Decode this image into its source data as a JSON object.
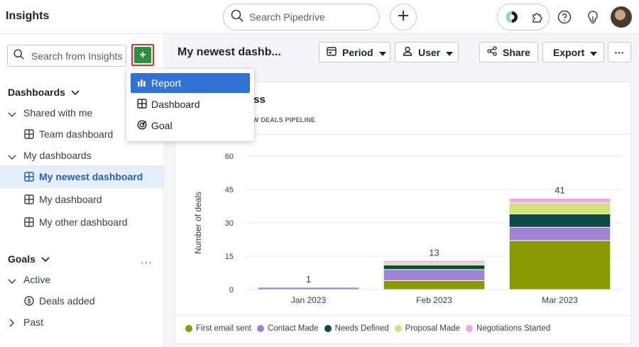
{
  "app": {
    "title": "Insights"
  },
  "topbar": {
    "search_placeholder": "Search Pipedrive",
    "icons": [
      "search-icon",
      "plus-icon",
      "sales-assistant-icon",
      "extensions-icon",
      "help-icon",
      "lightbulb-icon",
      "avatar"
    ]
  },
  "sidebar": {
    "search_placeholder": "Search from Insights",
    "add_label": "+",
    "dashboards_label": "Dashboards",
    "shared_label": "Shared with me",
    "team_dashboard": "Team dashboard",
    "my_dashboards_label": "My dashboards",
    "items": [
      "My newest dashboard",
      "My dashboard",
      "My other dashboard"
    ],
    "goals_label": "Goals",
    "goals_more": "···",
    "active_label": "Active",
    "deals_added": "Deals added",
    "past_label": "Past"
  },
  "menu": {
    "items": [
      "Report",
      "Dashboard",
      "Goal"
    ]
  },
  "main": {
    "dashboard_title": "My newest dashb...",
    "toolbar": {
      "period": "Period",
      "user": "User",
      "share": "Share",
      "export": "Export",
      "more": "···"
    }
  },
  "report": {
    "title": "ress",
    "subtitle": "NEW DEALS PIPELINE"
  },
  "colors": {
    "first_email_sent": "#879a00",
    "contact_made": "#9f84d6",
    "needs_defined": "#0e4a45",
    "proposal_made": "#d4e27c",
    "negotiations_started": "#e8a9e4",
    "accent": "#3172d6",
    "add_button": "#2d8f42"
  },
  "chart_data": {
    "type": "bar",
    "stacked": true,
    "categories": [
      "Jan 2023",
      "Feb 2023",
      "Mar 2023"
    ],
    "ylabel": "Number of deals",
    "ylim": [
      0,
      60
    ],
    "yticks": [
      0,
      15,
      30,
      45,
      60
    ],
    "totals": [
      1,
      13,
      41
    ],
    "series": [
      {
        "name": "First email sent",
        "color": "#879a00",
        "values": [
          0,
          4,
          22
        ]
      },
      {
        "name": "Contact Made",
        "color": "#9f84d6",
        "values": [
          1,
          5,
          6
        ]
      },
      {
        "name": "Needs Defined",
        "color": "#0e4a45",
        "values": [
          0,
          2,
          6
        ]
      },
      {
        "name": "Proposal Made",
        "color": "#d4e27c",
        "values": [
          0,
          1,
          5
        ]
      },
      {
        "name": "Negotiations Started",
        "color": "#e8a9e4",
        "values": [
          0,
          1,
          2
        ]
      }
    ],
    "grid": true,
    "legend_position": "bottom"
  }
}
